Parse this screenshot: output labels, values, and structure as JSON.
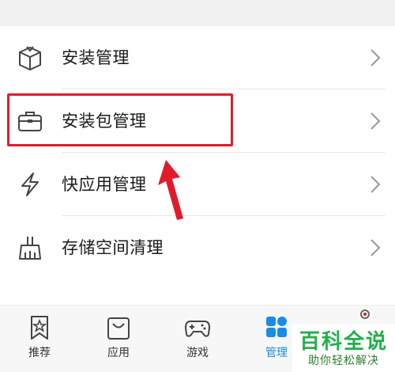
{
  "menu": {
    "items": [
      {
        "label": "安装管理",
        "icon": "package-box-icon"
      },
      {
        "label": "安装包管理",
        "icon": "briefcase-icon"
      },
      {
        "label": "快应用管理",
        "icon": "lightning-icon"
      },
      {
        "label": "存储空间清理",
        "icon": "broom-icon"
      }
    ]
  },
  "tabbar": {
    "tabs": [
      {
        "label": "推荐",
        "icon": "bookmark-star-icon"
      },
      {
        "label": "应用",
        "icon": "shopping-bag-icon"
      },
      {
        "label": "游戏",
        "icon": "gamepad-icon"
      },
      {
        "label": "管理",
        "icon": "grid-apps-icon",
        "active": true
      }
    ]
  },
  "watermark": {
    "title": "百科全说",
    "subtitle": "助你轻松解决"
  },
  "colors": {
    "accent": "#1a8ce6",
    "highlight": "#e21b2a",
    "watermark": "#20b04a"
  }
}
